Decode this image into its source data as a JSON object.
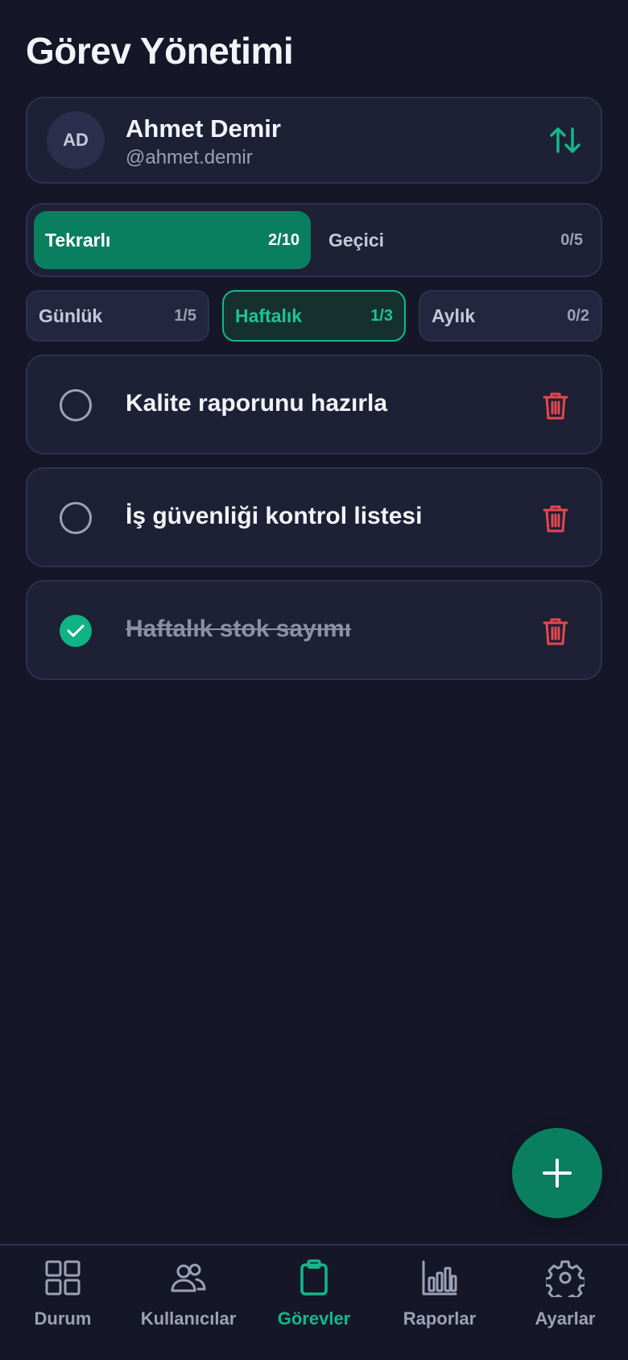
{
  "page_title": "Görev Yönetimi",
  "user": {
    "initials": "AD",
    "name": "Ahmet Demir",
    "handle": "@ahmet.demir"
  },
  "type_tabs": [
    {
      "label": "Tekrarlı",
      "count": "2/10",
      "active": true
    },
    {
      "label": "Geçici",
      "count": "0/5",
      "active": false
    }
  ],
  "period_tabs": [
    {
      "label": "Günlük",
      "count": "1/5",
      "active": false
    },
    {
      "label": "Haftalık",
      "count": "1/3",
      "active": true
    },
    {
      "label": "Aylık",
      "count": "0/2",
      "active": false
    }
  ],
  "tasks": [
    {
      "title": "Kalite raporunu hazırla",
      "done": false
    },
    {
      "title": "İş güvenliği kontrol listesi",
      "done": false
    },
    {
      "title": "Haftalık stok sayımı",
      "done": true
    }
  ],
  "nav": [
    {
      "label": "Durum",
      "icon": "grid-icon",
      "active": false
    },
    {
      "label": "Kullanıcılar",
      "icon": "users-icon",
      "active": false
    },
    {
      "label": "Görevler",
      "icon": "clipboard-icon",
      "active": true
    },
    {
      "label": "Raporlar",
      "icon": "bar-chart-icon",
      "active": false
    },
    {
      "label": "Ayarlar",
      "icon": "gear-icon",
      "active": false
    }
  ],
  "colors": {
    "accent": "#0a7f5f",
    "accent_bright": "#14b889",
    "danger": "#e5484d",
    "background": "#151729",
    "card": "#1e2036"
  }
}
